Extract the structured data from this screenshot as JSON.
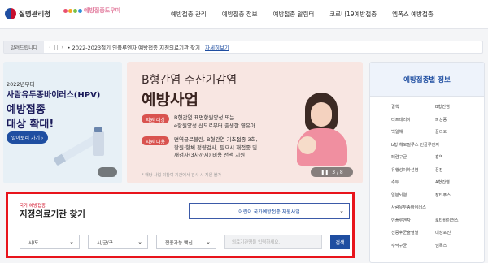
{
  "header": {
    "logo_kdca": "질병관리청",
    "logo_vaccine": "예방접종도우미",
    "nav": [
      "예방접종 관리",
      "예방접종 정보",
      "예방접종 알림터",
      "코로나19예방접종",
      "엠폭스 예방접종"
    ]
  },
  "notice": {
    "badge": "알려드립니다",
    "controls": "‹ || ›",
    "text": "• 2022-2023절기 인플루엔자 예방접종 지정의료기관 찾기",
    "link": "자세히보기"
  },
  "slide_left": {
    "line1": "2022년부터",
    "line2": "사람유두종바이러스(HPV)",
    "line3": "예방접종",
    "line4": "대상 확대!",
    "button": "알아보러 가기 ›"
  },
  "slide_main": {
    "title": "B형간염 주산기감염",
    "headline": "예방사업",
    "target_tag": "지원 대상",
    "target_lines": [
      "B형간염 표면항원양성 또는",
      "e항원양성 산모로부터 출생한 영유아"
    ],
    "content_tag": "지원 내용",
    "content_lines": [
      "면역글로불린, B형간염 기초접종 3회,",
      "항원·항체 정량검사, 필요시 재접종 및",
      "재검사(3차까지) 비용 전액 지원"
    ],
    "footnote": "* 해당 사업 미참여 기관에서 검사 시 지원 불가",
    "pager": "3 / 8"
  },
  "info": {
    "title": "예방접종별 정보",
    "items": [
      [
        "결핵",
        "B형간염"
      ],
      [
        "디프테리아",
        "파상풍"
      ],
      [
        "백일해",
        "폴리오"
      ],
      [
        "b형 헤모필루스 인플루엔자",
        ""
      ],
      [
        "폐렴구균",
        "홍역"
      ],
      [
        "유행성이하선염",
        "풍진"
      ],
      [
        "수두",
        "A형간염"
      ],
      [
        "일본뇌염",
        "장티푸스"
      ],
      [
        "사람유두종바이러스",
        ""
      ],
      [
        "인플루엔자",
        "로타바이러스"
      ],
      [
        "신증후군출혈열",
        "대상포진"
      ],
      [
        "수막구균",
        "엠폭스"
      ]
    ]
  },
  "search": {
    "small_label": "국가 예방접종",
    "title": "지정의료기관 찾기",
    "program_select": "어린이 국가예방접종 지원사업",
    "province": "시/도",
    "district": "시/군/구",
    "vaccine": "접종가능 백신",
    "input_placeholder": "의료기관명을 입력하세요.",
    "button": "검색"
  },
  "colors": {
    "brand": "#1f4ea1",
    "highlight": "#e8141c",
    "tag": "#d9534f"
  }
}
